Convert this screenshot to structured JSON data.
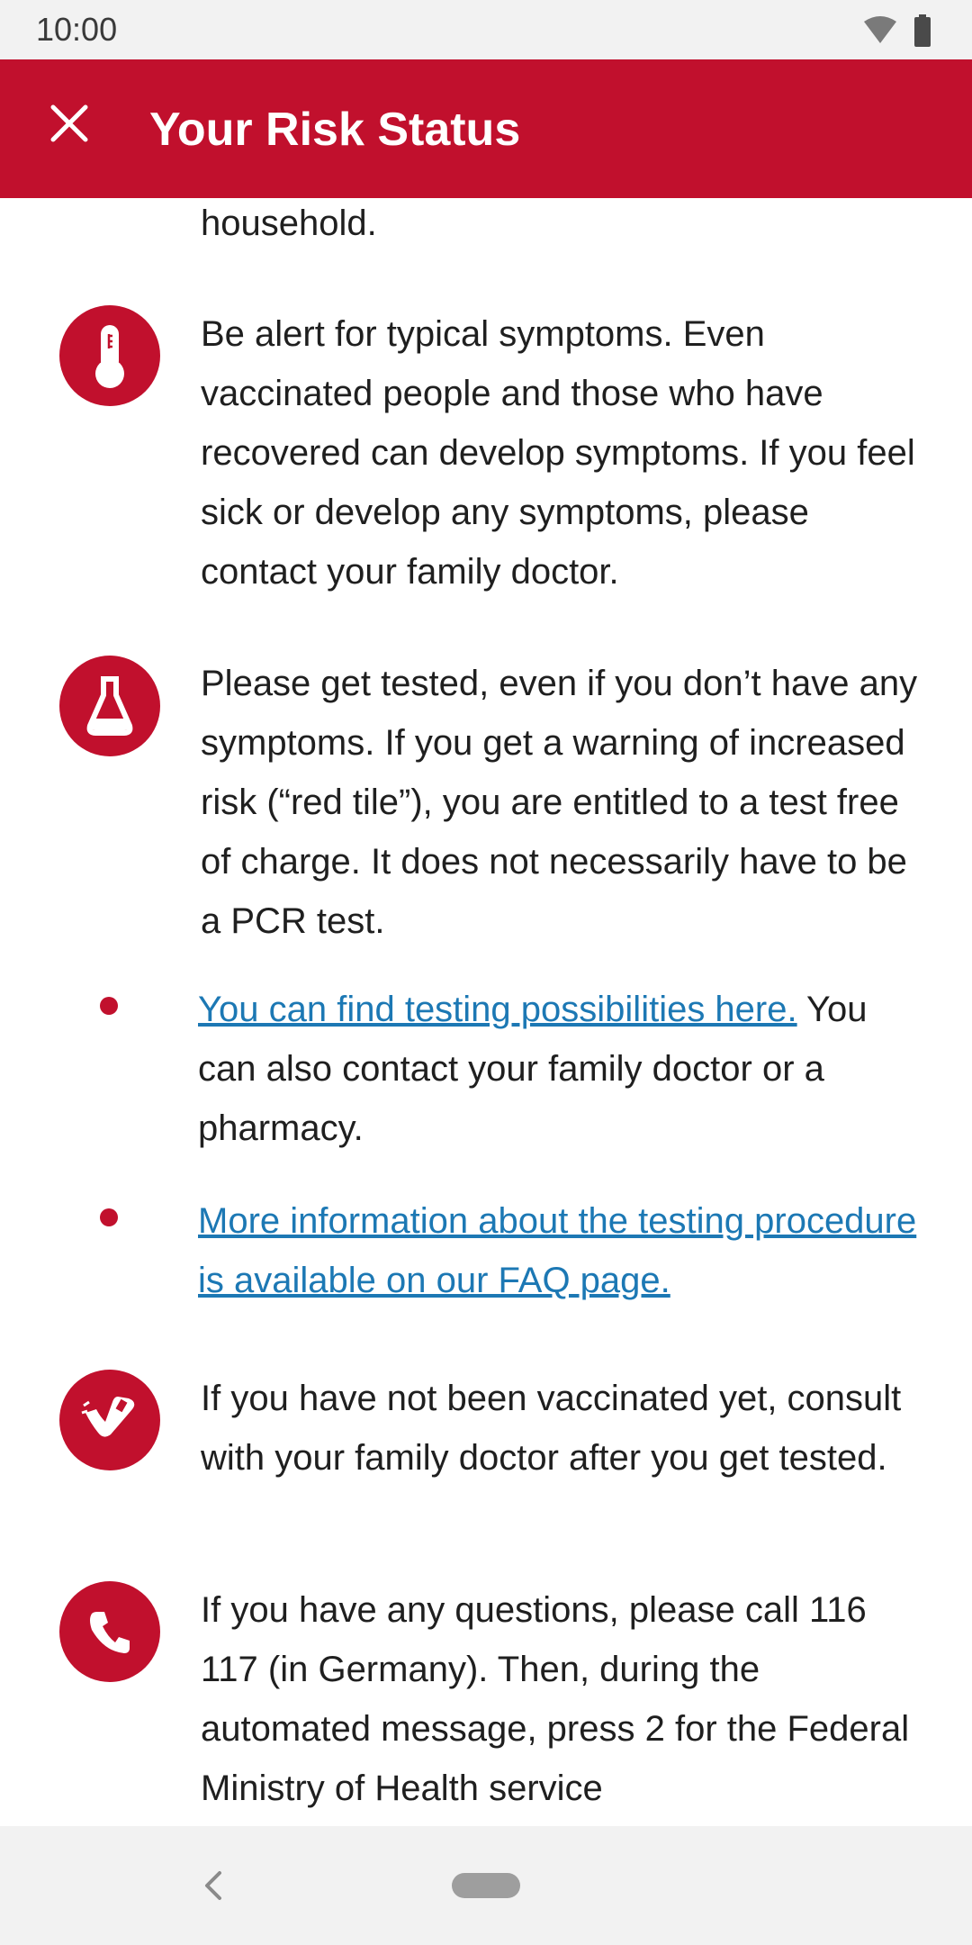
{
  "status_bar": {
    "time": "10:00",
    "icons": [
      "wifi-icon",
      "battery-icon"
    ]
  },
  "app_bar": {
    "title": "Your Risk Status",
    "close_icon": "close-icon",
    "color": "#c1102d"
  },
  "content": {
    "partial_top_text": "household.",
    "sections": [
      {
        "icon": "thermometer-icon",
        "text": "Be alert for typical symptoms. Even vaccinated people and those who have recovered can develop symptoms. If you feel sick or develop any symptoms, please contact your family doctor."
      },
      {
        "icon": "flask-icon",
        "text": "Please get tested, even if you don’t have any symptoms. If you get a warning of increased risk (“red tile”), you are entitled to a test free of charge. It does not necessarily have to be a PCR test."
      },
      {
        "icon": "vaccine-arm-icon",
        "text": "If you have not been vaccinated yet, consult with your family doctor after you get tested."
      },
      {
        "icon": "phone-icon",
        "text": "If you have any questions, please call 116 117 (in Germany). Then, during the automated message, press 2 for the Federal Ministry of Health service"
      }
    ],
    "bullets": [
      {
        "link_text": "You can find testing possibilities here.",
        "after_text": "You can also contact your family doctor or a pharmacy."
      },
      {
        "link_text": "More information about the testing procedure is available on our FAQ page.",
        "after_text": ""
      }
    ]
  },
  "colors": {
    "accent": "#c1102d",
    "link": "#1c78b4"
  },
  "nav_bar": {
    "icons": [
      "back-icon",
      "home-pill"
    ]
  }
}
